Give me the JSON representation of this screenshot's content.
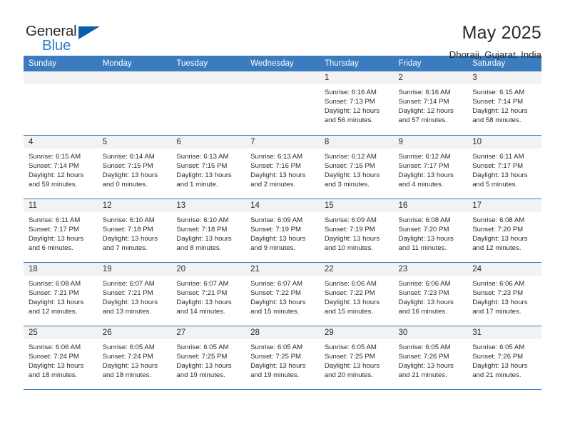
{
  "brand": {
    "name_top": "General",
    "name_bottom": "Blue",
    "triangle_color": "#0b5ea8",
    "blue_color": "#2a7fc9"
  },
  "header": {
    "title": "May 2025",
    "subtitle": "Dhoraji, Gujarat, India"
  },
  "theme": {
    "header_blue": "#3a7cbe",
    "daynum_gray": "#f2f2f2",
    "text": "#2b2b2b"
  },
  "weekday_headers": [
    "Sunday",
    "Monday",
    "Tuesday",
    "Wednesday",
    "Thursday",
    "Friday",
    "Saturday"
  ],
  "weeks": [
    [
      {
        "day": "",
        "lines": []
      },
      {
        "day": "",
        "lines": []
      },
      {
        "day": "",
        "lines": []
      },
      {
        "day": "",
        "lines": []
      },
      {
        "day": "1",
        "lines": [
          "Sunrise: 6:16 AM",
          "Sunset: 7:13 PM",
          "Daylight: 12 hours",
          "and 56 minutes."
        ]
      },
      {
        "day": "2",
        "lines": [
          "Sunrise: 6:16 AM",
          "Sunset: 7:14 PM",
          "Daylight: 12 hours",
          "and 57 minutes."
        ]
      },
      {
        "day": "3",
        "lines": [
          "Sunrise: 6:15 AM",
          "Sunset: 7:14 PM",
          "Daylight: 12 hours",
          "and 58 minutes."
        ]
      }
    ],
    [
      {
        "day": "4",
        "lines": [
          "Sunrise: 6:15 AM",
          "Sunset: 7:14 PM",
          "Daylight: 12 hours",
          "and 59 minutes."
        ]
      },
      {
        "day": "5",
        "lines": [
          "Sunrise: 6:14 AM",
          "Sunset: 7:15 PM",
          "Daylight: 13 hours",
          "and 0 minutes."
        ]
      },
      {
        "day": "6",
        "lines": [
          "Sunrise: 6:13 AM",
          "Sunset: 7:15 PM",
          "Daylight: 13 hours",
          "and 1 minute."
        ]
      },
      {
        "day": "7",
        "lines": [
          "Sunrise: 6:13 AM",
          "Sunset: 7:16 PM",
          "Daylight: 13 hours",
          "and 2 minutes."
        ]
      },
      {
        "day": "8",
        "lines": [
          "Sunrise: 6:12 AM",
          "Sunset: 7:16 PM",
          "Daylight: 13 hours",
          "and 3 minutes."
        ]
      },
      {
        "day": "9",
        "lines": [
          "Sunrise: 6:12 AM",
          "Sunset: 7:17 PM",
          "Daylight: 13 hours",
          "and 4 minutes."
        ]
      },
      {
        "day": "10",
        "lines": [
          "Sunrise: 6:11 AM",
          "Sunset: 7:17 PM",
          "Daylight: 13 hours",
          "and 5 minutes."
        ]
      }
    ],
    [
      {
        "day": "11",
        "lines": [
          "Sunrise: 6:11 AM",
          "Sunset: 7:17 PM",
          "Daylight: 13 hours",
          "and 6 minutes."
        ]
      },
      {
        "day": "12",
        "lines": [
          "Sunrise: 6:10 AM",
          "Sunset: 7:18 PM",
          "Daylight: 13 hours",
          "and 7 minutes."
        ]
      },
      {
        "day": "13",
        "lines": [
          "Sunrise: 6:10 AM",
          "Sunset: 7:18 PM",
          "Daylight: 13 hours",
          "and 8 minutes."
        ]
      },
      {
        "day": "14",
        "lines": [
          "Sunrise: 6:09 AM",
          "Sunset: 7:19 PM",
          "Daylight: 13 hours",
          "and 9 minutes."
        ]
      },
      {
        "day": "15",
        "lines": [
          "Sunrise: 6:09 AM",
          "Sunset: 7:19 PM",
          "Daylight: 13 hours",
          "and 10 minutes."
        ]
      },
      {
        "day": "16",
        "lines": [
          "Sunrise: 6:08 AM",
          "Sunset: 7:20 PM",
          "Daylight: 13 hours",
          "and 11 minutes."
        ]
      },
      {
        "day": "17",
        "lines": [
          "Sunrise: 6:08 AM",
          "Sunset: 7:20 PM",
          "Daylight: 13 hours",
          "and 12 minutes."
        ]
      }
    ],
    [
      {
        "day": "18",
        "lines": [
          "Sunrise: 6:08 AM",
          "Sunset: 7:21 PM",
          "Daylight: 13 hours",
          "and 12 minutes."
        ]
      },
      {
        "day": "19",
        "lines": [
          "Sunrise: 6:07 AM",
          "Sunset: 7:21 PM",
          "Daylight: 13 hours",
          "and 13 minutes."
        ]
      },
      {
        "day": "20",
        "lines": [
          "Sunrise: 6:07 AM",
          "Sunset: 7:21 PM",
          "Daylight: 13 hours",
          "and 14 minutes."
        ]
      },
      {
        "day": "21",
        "lines": [
          "Sunrise: 6:07 AM",
          "Sunset: 7:22 PM",
          "Daylight: 13 hours",
          "and 15 minutes."
        ]
      },
      {
        "day": "22",
        "lines": [
          "Sunrise: 6:06 AM",
          "Sunset: 7:22 PM",
          "Daylight: 13 hours",
          "and 15 minutes."
        ]
      },
      {
        "day": "23",
        "lines": [
          "Sunrise: 6:06 AM",
          "Sunset: 7:23 PM",
          "Daylight: 13 hours",
          "and 16 minutes."
        ]
      },
      {
        "day": "24",
        "lines": [
          "Sunrise: 6:06 AM",
          "Sunset: 7:23 PM",
          "Daylight: 13 hours",
          "and 17 minutes."
        ]
      }
    ],
    [
      {
        "day": "25",
        "lines": [
          "Sunrise: 6:06 AM",
          "Sunset: 7:24 PM",
          "Daylight: 13 hours",
          "and 18 minutes."
        ]
      },
      {
        "day": "26",
        "lines": [
          "Sunrise: 6:05 AM",
          "Sunset: 7:24 PM",
          "Daylight: 13 hours",
          "and 18 minutes."
        ]
      },
      {
        "day": "27",
        "lines": [
          "Sunrise: 6:05 AM",
          "Sunset: 7:25 PM",
          "Daylight: 13 hours",
          "and 19 minutes."
        ]
      },
      {
        "day": "28",
        "lines": [
          "Sunrise: 6:05 AM",
          "Sunset: 7:25 PM",
          "Daylight: 13 hours",
          "and 19 minutes."
        ]
      },
      {
        "day": "29",
        "lines": [
          "Sunrise: 6:05 AM",
          "Sunset: 7:25 PM",
          "Daylight: 13 hours",
          "and 20 minutes."
        ]
      },
      {
        "day": "30",
        "lines": [
          "Sunrise: 6:05 AM",
          "Sunset: 7:26 PM",
          "Daylight: 13 hours",
          "and 21 minutes."
        ]
      },
      {
        "day": "31",
        "lines": [
          "Sunrise: 6:05 AM",
          "Sunset: 7:26 PM",
          "Daylight: 13 hours",
          "and 21 minutes."
        ]
      }
    ]
  ]
}
